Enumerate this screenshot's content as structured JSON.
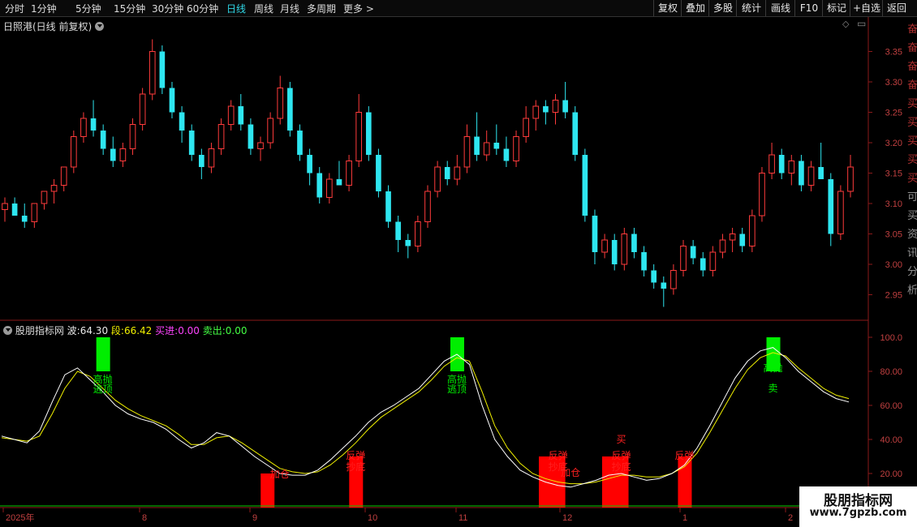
{
  "toolbar": {
    "periods": [
      "分时",
      "1分钟",
      "5分钟",
      "15分钟",
      "30分钟",
      "60分钟",
      "日线",
      "周线",
      "月线",
      "多周期",
      "更多 >"
    ],
    "active_period": "日线",
    "actions": [
      "复权",
      "叠加",
      "多股",
      "统计",
      "画线",
      "F10",
      "标记",
      "+自选",
      "返回"
    ]
  },
  "main_chart": {
    "title": "日照港(日线 前复权)",
    "price_ticks": [
      "3.35",
      "3.30",
      "3.25",
      "3.20",
      "3.15",
      "3.10",
      "3.05",
      "3.00",
      "2.95"
    ],
    "up_color": "#ff3b3b",
    "down_color": "#2ee6f0"
  },
  "indicator": {
    "name": "股朋指标网",
    "wave_label": "波:",
    "wave_value": "64.30",
    "seg_label": "段:",
    "seg_value": "66.42",
    "buy_label": "买进:",
    "buy_value": "0.00",
    "sell_label": "卖出:",
    "sell_value": "0.00",
    "ticks": [
      "100.0",
      "80.00",
      "60.00",
      "40.00",
      "20.00"
    ]
  },
  "date_axis": [
    "2025年",
    "8",
    "9",
    "10",
    "11",
    "12",
    "1",
    "2"
  ],
  "signals": {
    "sell_a": "高抛",
    "sell_b": "逃顶",
    "rebound": "反弹",
    "bottom": "抄底",
    "add": "加仓",
    "buy": "买",
    "sell": "卖"
  },
  "right_edge_chars": [
    "奋",
    "奋",
    "奋",
    "奋",
    "买",
    "买",
    "买",
    "买",
    "买",
    "可",
    "买",
    "资",
    "讯",
    "分",
    "析"
  ],
  "watermark": {
    "line1": "股朋指标网",
    "line2": "www.7gpzb.com"
  },
  "chart_data": {
    "type": "candlestick",
    "title": "日照港(日线 前复权)",
    "ylim": [
      2.92,
      3.38
    ],
    "indicator_ylim": [
      0,
      100
    ],
    "wave_series_name": "波",
    "seg_series_name": "段",
    "candles": [
      [
        3.09,
        3.11,
        3.07,
        3.1
      ],
      [
        3.1,
        3.11,
        3.08,
        3.08
      ],
      [
        3.08,
        3.1,
        3.06,
        3.07
      ],
      [
        3.07,
        3.1,
        3.06,
        3.1
      ],
      [
        3.1,
        3.12,
        3.09,
        3.12
      ],
      [
        3.12,
        3.14,
        3.1,
        3.13
      ],
      [
        3.13,
        3.16,
        3.12,
        3.16
      ],
      [
        3.16,
        3.22,
        3.15,
        3.21
      ],
      [
        3.21,
        3.25,
        3.2,
        3.24
      ],
      [
        3.24,
        3.27,
        3.21,
        3.22
      ],
      [
        3.22,
        3.23,
        3.18,
        3.19
      ],
      [
        3.19,
        3.21,
        3.16,
        3.17
      ],
      [
        3.17,
        3.2,
        3.16,
        3.19
      ],
      [
        3.19,
        3.24,
        3.18,
        3.23
      ],
      [
        3.23,
        3.29,
        3.22,
        3.28
      ],
      [
        3.28,
        3.37,
        3.27,
        3.35
      ],
      [
        3.35,
        3.36,
        3.28,
        3.29
      ],
      [
        3.29,
        3.3,
        3.24,
        3.25
      ],
      [
        3.25,
        3.26,
        3.2,
        3.22
      ],
      [
        3.22,
        3.23,
        3.17,
        3.18
      ],
      [
        3.18,
        3.19,
        3.14,
        3.16
      ],
      [
        3.16,
        3.2,
        3.15,
        3.19
      ],
      [
        3.19,
        3.24,
        3.18,
        3.23
      ],
      [
        3.23,
        3.27,
        3.22,
        3.26
      ],
      [
        3.26,
        3.28,
        3.22,
        3.23
      ],
      [
        3.23,
        3.24,
        3.18,
        3.19
      ],
      [
        3.19,
        3.21,
        3.17,
        3.2
      ],
      [
        3.2,
        3.25,
        3.19,
        3.24
      ],
      [
        3.24,
        3.31,
        3.23,
        3.29
      ],
      [
        3.29,
        3.3,
        3.21,
        3.22
      ],
      [
        3.22,
        3.23,
        3.17,
        3.18
      ],
      [
        3.18,
        3.19,
        3.13,
        3.15
      ],
      [
        3.15,
        3.16,
        3.1,
        3.11
      ],
      [
        3.11,
        3.15,
        3.1,
        3.14
      ],
      [
        3.14,
        3.17,
        3.13,
        3.13
      ],
      [
        3.13,
        3.18,
        3.12,
        3.17
      ],
      [
        3.17,
        3.28,
        3.16,
        3.25
      ],
      [
        3.25,
        3.26,
        3.17,
        3.18
      ],
      [
        3.18,
        3.19,
        3.11,
        3.12
      ],
      [
        3.12,
        3.13,
        3.06,
        3.07
      ],
      [
        3.07,
        3.08,
        3.02,
        3.04
      ],
      [
        3.04,
        3.05,
        3.01,
        3.03
      ],
      [
        3.03,
        3.08,
        3.02,
        3.07
      ],
      [
        3.07,
        3.13,
        3.06,
        3.12
      ],
      [
        3.12,
        3.17,
        3.11,
        3.16
      ],
      [
        3.16,
        3.17,
        3.13,
        3.14
      ],
      [
        3.14,
        3.18,
        3.13,
        3.16
      ],
      [
        3.16,
        3.23,
        3.15,
        3.21
      ],
      [
        3.21,
        3.25,
        3.17,
        3.18
      ],
      [
        3.18,
        3.22,
        3.17,
        3.2
      ],
      [
        3.2,
        3.23,
        3.18,
        3.19
      ],
      [
        3.19,
        3.21,
        3.16,
        3.17
      ],
      [
        3.17,
        3.22,
        3.16,
        3.21
      ],
      [
        3.21,
        3.26,
        3.2,
        3.24
      ],
      [
        3.24,
        3.27,
        3.22,
        3.26
      ],
      [
        3.26,
        3.27,
        3.23,
        3.25
      ],
      [
        3.25,
        3.28,
        3.23,
        3.27
      ],
      [
        3.27,
        3.3,
        3.24,
        3.25
      ],
      [
        3.25,
        3.26,
        3.17,
        3.18
      ],
      [
        3.18,
        3.19,
        3.07,
        3.08
      ],
      [
        3.08,
        3.09,
        3.0,
        3.02
      ],
      [
        3.02,
        3.05,
        3.01,
        3.04
      ],
      [
        3.04,
        3.05,
        2.99,
        3.0
      ],
      [
        3.0,
        3.06,
        2.99,
        3.05
      ],
      [
        3.05,
        3.06,
        3.01,
        3.02
      ],
      [
        3.02,
        3.03,
        2.98,
        2.99
      ],
      [
        2.99,
        3.0,
        2.96,
        2.97
      ],
      [
        2.97,
        2.98,
        2.93,
        2.96
      ],
      [
        2.96,
        3.0,
        2.95,
        2.99
      ],
      [
        2.99,
        3.04,
        2.98,
        3.03
      ],
      [
        3.03,
        3.04,
        3.0,
        3.01
      ],
      [
        3.01,
        3.02,
        2.98,
        2.99
      ],
      [
        2.99,
        3.03,
        2.98,
        3.02
      ],
      [
        3.02,
        3.05,
        3.01,
        3.04
      ],
      [
        3.04,
        3.06,
        3.02,
        3.05
      ],
      [
        3.05,
        3.06,
        3.02,
        3.03
      ],
      [
        3.03,
        3.09,
        3.02,
        3.08
      ],
      [
        3.08,
        3.16,
        3.07,
        3.15
      ],
      [
        3.15,
        3.2,
        3.14,
        3.18
      ],
      [
        3.18,
        3.19,
        3.14,
        3.15
      ],
      [
        3.15,
        3.18,
        3.13,
        3.17
      ],
      [
        3.17,
        3.18,
        3.12,
        3.13
      ],
      [
        3.13,
        3.17,
        3.12,
        3.16
      ],
      [
        3.16,
        3.2,
        3.15,
        3.14
      ],
      [
        3.14,
        3.15,
        3.03,
        3.05
      ],
      [
        3.05,
        3.13,
        3.04,
        3.12
      ],
      [
        3.12,
        3.18,
        3.11,
        3.16
      ]
    ],
    "wave": [
      42,
      40,
      38,
      45,
      62,
      78,
      82,
      75,
      68,
      60,
      55,
      52,
      50,
      46,
      40,
      35,
      38,
      44,
      42,
      36,
      30,
      25,
      20,
      19,
      19,
      22,
      28,
      35,
      42,
      50,
      56,
      60,
      65,
      70,
      78,
      86,
      90,
      84,
      60,
      40,
      30,
      22,
      18,
      15,
      13,
      12,
      14,
      16,
      19,
      20,
      18,
      16,
      17,
      20,
      25,
      35,
      48,
      62,
      76,
      86,
      92,
      94,
      88,
      80,
      74,
      68,
      64,
      62
    ],
    "seg": [
      41,
      40,
      39,
      42,
      55,
      70,
      80,
      77,
      70,
      63,
      58,
      54,
      51,
      48,
      43,
      37,
      37,
      41,
      42,
      38,
      33,
      28,
      23,
      21,
      20,
      21,
      25,
      31,
      38,
      46,
      53,
      58,
      63,
      68,
      75,
      83,
      88,
      86,
      68,
      48,
      35,
      26,
      20,
      17,
      15,
      14,
      14,
      15,
      17,
      19,
      19,
      18,
      18,
      20,
      24,
      32,
      44,
      57,
      70,
      81,
      88,
      91,
      89,
      82,
      76,
      70,
      66,
      64
    ]
  }
}
